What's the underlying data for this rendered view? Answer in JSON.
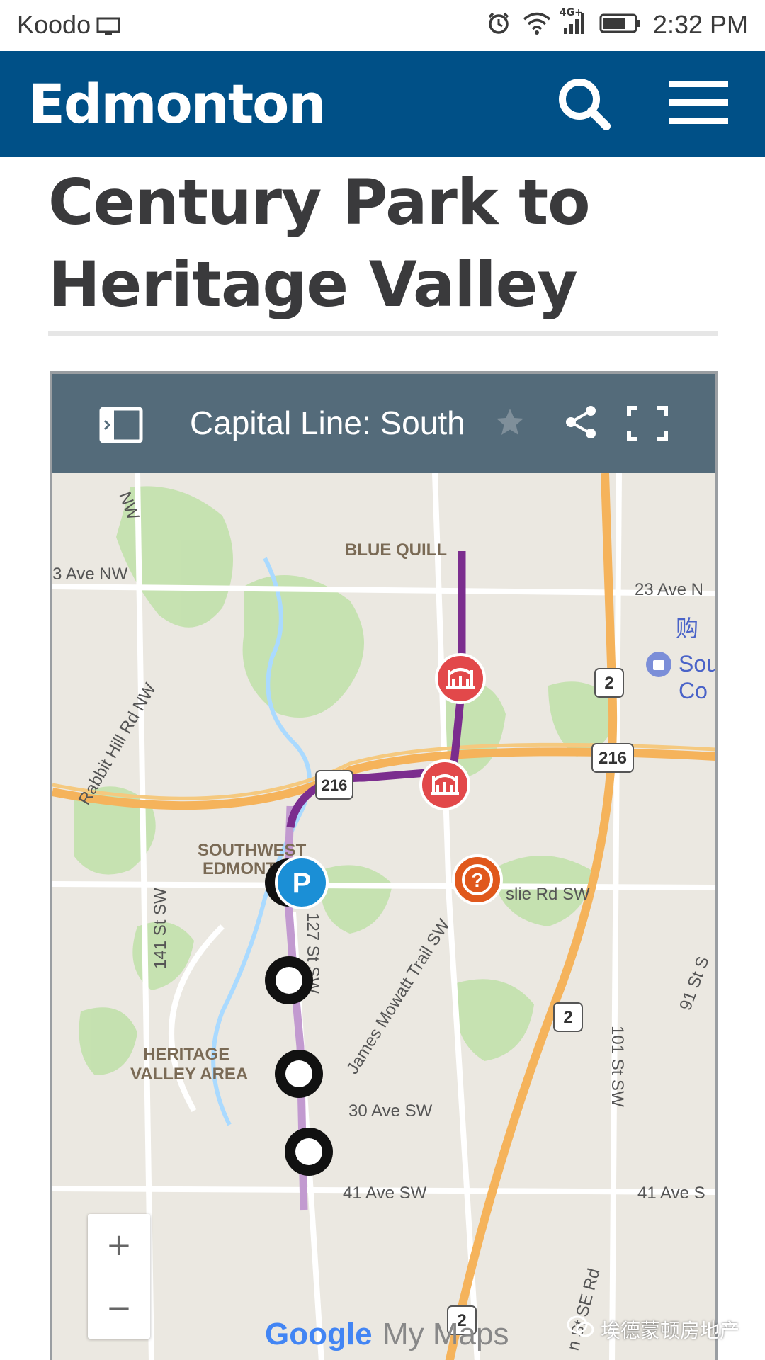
{
  "status_bar": {
    "carrier": "Koodo",
    "network": "4G+",
    "time": "2:32 PM"
  },
  "header": {
    "logo": "Edmonton",
    "brand_color": "#005087"
  },
  "page": {
    "title_line1": "Century Park to",
    "title_line2": "Heritage Valley"
  },
  "map": {
    "title": "Capital Line: South",
    "labels": {
      "blue_quill": "BLUE QUILL",
      "ave_23_left": "3 Ave NW",
      "ave_23_right": "23 Ave N",
      "rabbit_hill": "Rabbit Hill Rd NW",
      "hwy_216_a": "216",
      "hwy_216_b": "216",
      "hwy_2_a": "2",
      "hwy_2_b": "2",
      "hwy_2_c": "2",
      "southwest_line1": "SOUTHWEST",
      "southwest_line2": "EDMONT",
      "ellerslie": "slie Rd SW",
      "st_141": "141 St SW",
      "st_127": "127 St SW",
      "james_mowatt": "James Mowatt Trail SW",
      "heritage_line1": "HERITAGE",
      "heritage_line2": "VALLEY AREA",
      "ave_30": "30 Ave SW",
      "ave_41_left": "41 Ave SW",
      "ave_41_right": "41 Ave S",
      "st_101": "101 St SW",
      "st_91": "91 St S",
      "nw_top": "NW",
      "poi_cn": "购",
      "poi_sou": "Sou",
      "poi_co": "Co",
      "sc_rd": "n St SE Rd"
    },
    "zoom_in": "+",
    "zoom_out": "−",
    "attribution_google": "Google",
    "attribution_mymaps": "My Maps",
    "line_color": "#7b2d8e",
    "future_line_color": "#c29ad0"
  },
  "watermark": "埃德蒙顿房地产"
}
